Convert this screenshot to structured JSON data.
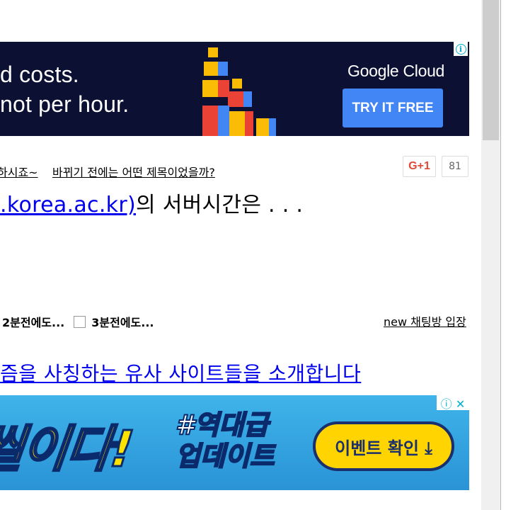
{
  "ad_top": {
    "line1": "d costs.",
    "line2": "not per hour.",
    "brand": "Google Cloud",
    "cta": "TRY IT FREE",
    "info_glyph": "i"
  },
  "links": {
    "link1": "하시죠~",
    "link2": "바뀌기 전에는 어떤 제목이었을까?"
  },
  "social": {
    "gplus": "G+1",
    "count": "81"
  },
  "headline": {
    "link": ".korea.ac.kr)",
    "rest": "의 서버시간은 . . ."
  },
  "options": {
    "opt1": "2분전에도...",
    "opt2": "3분전에도..."
  },
  "chat_link": "new 채팅방 입장",
  "article_link": "즘을 사칭하는 유사 사이트들을 소개합니다",
  "ad_bottom": {
    "hero": "씰이다!",
    "tag1": "#역대급",
    "tag2": "업데이트",
    "button": "이벤트 확인 ⤓",
    "close_glyph": "ⓘ ✕"
  },
  "colors": {
    "link_blue": "#0000ee",
    "ad_dark": "#0c1133",
    "google_blue": "#4285f4",
    "ad_yellow": "#ffd400"
  }
}
